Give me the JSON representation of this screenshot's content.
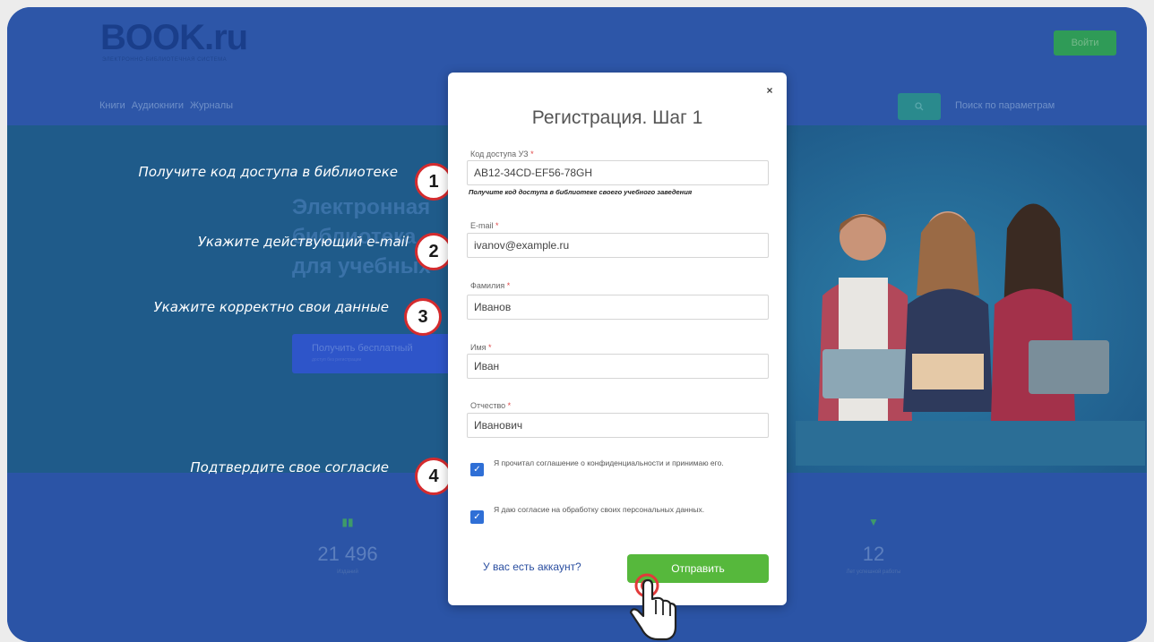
{
  "header": {
    "logo": "BOOK.ru",
    "logo_sub": "ЭЛЕКТРОННО-БИБЛИОТЕЧНАЯ СИСТЕМА",
    "login_label": "Войти",
    "nav": [
      "Книги",
      "Аудиокниги",
      "Журналы"
    ],
    "search_icon": "search-icon",
    "params_link": "Поиск по параметрам"
  },
  "hero": {
    "title_lines": [
      "Электронная",
      "библиотека",
      "для учебных"
    ],
    "free_button": "Получить бесплатный",
    "free_button_sub": "доступ без регистрации"
  },
  "stats": [
    {
      "icon": "book-icon",
      "value": "21 496",
      "label": "Изданий"
    },
    {
      "icon": "trophy-icon",
      "value": "12",
      "label": "Лет успешной работы"
    }
  ],
  "callouts": [
    {
      "number": "1",
      "text": "Получите код доступа в библиотеке"
    },
    {
      "number": "2",
      "text": "Укажите действующий e-mail"
    },
    {
      "number": "3",
      "text": "Укажите корректно свои данные"
    },
    {
      "number": "4",
      "text": "Подтвердите свое согласие"
    }
  ],
  "modal": {
    "close": "×",
    "title": "Регистрация. Шаг 1",
    "fields": {
      "access_code": {
        "label": "Код доступа УЗ",
        "value": "AB12-34CD-EF56-78GH"
      },
      "email": {
        "label": "E-mail",
        "value": "ivanov@example.ru"
      },
      "last_name": {
        "label": "Фамилия",
        "value": "Иванов"
      },
      "first_name": {
        "label": "Имя",
        "value": "Иван"
      },
      "middle_name": {
        "label": "Отчество",
        "value": "Иванович"
      }
    },
    "required_mark": "*",
    "hint": "Получите код доступа в библиотеке своего учебного заведения",
    "consent_privacy": "Я прочитал соглашение о конфиденциальности и принимаю его.",
    "consent_data": "Я даю согласие на обработку своих персональных данных.",
    "account_link": "У вас есть аккаунт?",
    "submit": "Отправить"
  },
  "colors": {
    "accent_blue": "#2b54a6",
    "submit_green": "#56b83c",
    "badge_red": "#d52b2e",
    "checkbox_blue": "#2f6fd6"
  }
}
